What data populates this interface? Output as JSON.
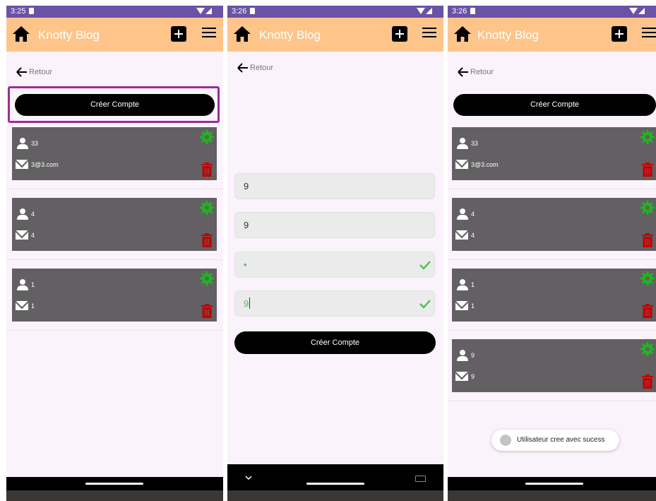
{
  "app": {
    "title": "Knotty Blog"
  },
  "panel1": {
    "time": "3:25"
  },
  "panel2": {
    "time": "3:26"
  },
  "panel3": {
    "time": "3:26"
  },
  "back_label": "Retour",
  "create_label": "Créer Compte",
  "users_before": [
    {
      "name": "33",
      "email": "3@3.com"
    },
    {
      "name": "4",
      "email": "4"
    },
    {
      "name": "1",
      "email": "1"
    }
  ],
  "users_after": [
    {
      "name": "33",
      "email": "3@3.com"
    },
    {
      "name": "4",
      "email": "4"
    },
    {
      "name": "1",
      "email": "1"
    },
    {
      "name": "9",
      "email": "9"
    }
  ],
  "form": {
    "username_value": "9",
    "email_value": "9",
    "password_value": "•",
    "confirm_value": "9"
  },
  "toast": {
    "message": "Utilisateur cree avec sucess"
  },
  "colors": {
    "status_bar": "#6a52a6",
    "app_bar": "#ffc48a",
    "card": "#626062",
    "gear": "#1fb51f",
    "trash": "#c20000",
    "check": "#4cc04c",
    "highlight": "#9b2d96"
  },
  "icons": [
    "home-icon",
    "add-icon",
    "menu-icon",
    "back-arrow-icon",
    "user-icon",
    "mail-icon",
    "gear-icon",
    "trash-icon",
    "check-icon",
    "chevron-down-icon",
    "keyboard-icon"
  ]
}
